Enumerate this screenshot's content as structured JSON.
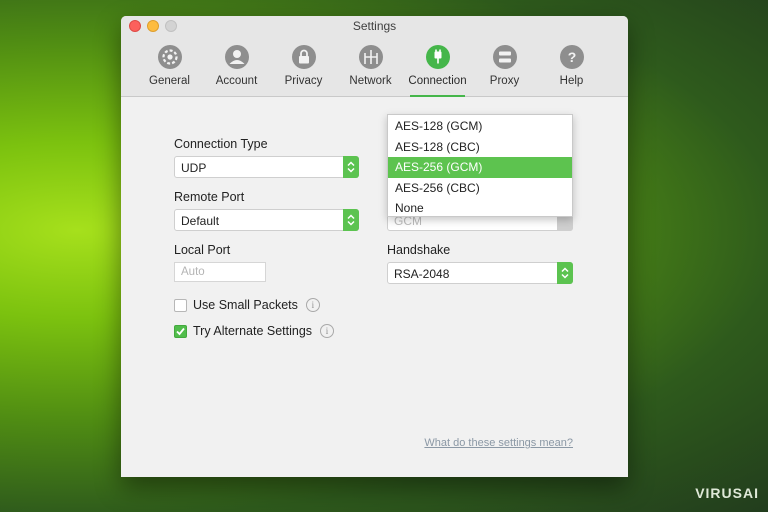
{
  "window": {
    "title": "Settings"
  },
  "tabs": [
    {
      "label": "General",
      "icon": "gear-icon"
    },
    {
      "label": "Account",
      "icon": "user-icon"
    },
    {
      "label": "Privacy",
      "icon": "lock-icon"
    },
    {
      "label": "Network",
      "icon": "network-icon"
    },
    {
      "label": "Connection",
      "icon": "connection-icon",
      "active": true
    },
    {
      "label": "Proxy",
      "icon": "proxy-icon"
    },
    {
      "label": "Help",
      "icon": "help-icon"
    }
  ],
  "form": {
    "connection_type": {
      "label": "Connection Type",
      "value": "UDP"
    },
    "remote_port": {
      "label": "Remote Port",
      "value": "Default"
    },
    "local_port": {
      "label": "Local Port",
      "placeholder": "Auto"
    },
    "small_packets": {
      "label": "Use Small Packets",
      "checked": false
    },
    "alternate_settings": {
      "label": "Try Alternate Settings",
      "checked": true
    },
    "encryption": {
      "hidden_value": "GCM",
      "options": [
        "AES-128 (GCM)",
        "AES-128 (CBC)",
        "AES-256 (GCM)",
        "AES-256 (CBC)",
        "None"
      ],
      "selected": "AES-256 (GCM)"
    },
    "handshake": {
      "label": "Handshake",
      "value": "RSA-2048"
    }
  },
  "help_link": "What do these settings mean?",
  "watermark": "VIRUSAI",
  "colors": {
    "accent": "#5cc350",
    "link": "#8b98a5"
  }
}
